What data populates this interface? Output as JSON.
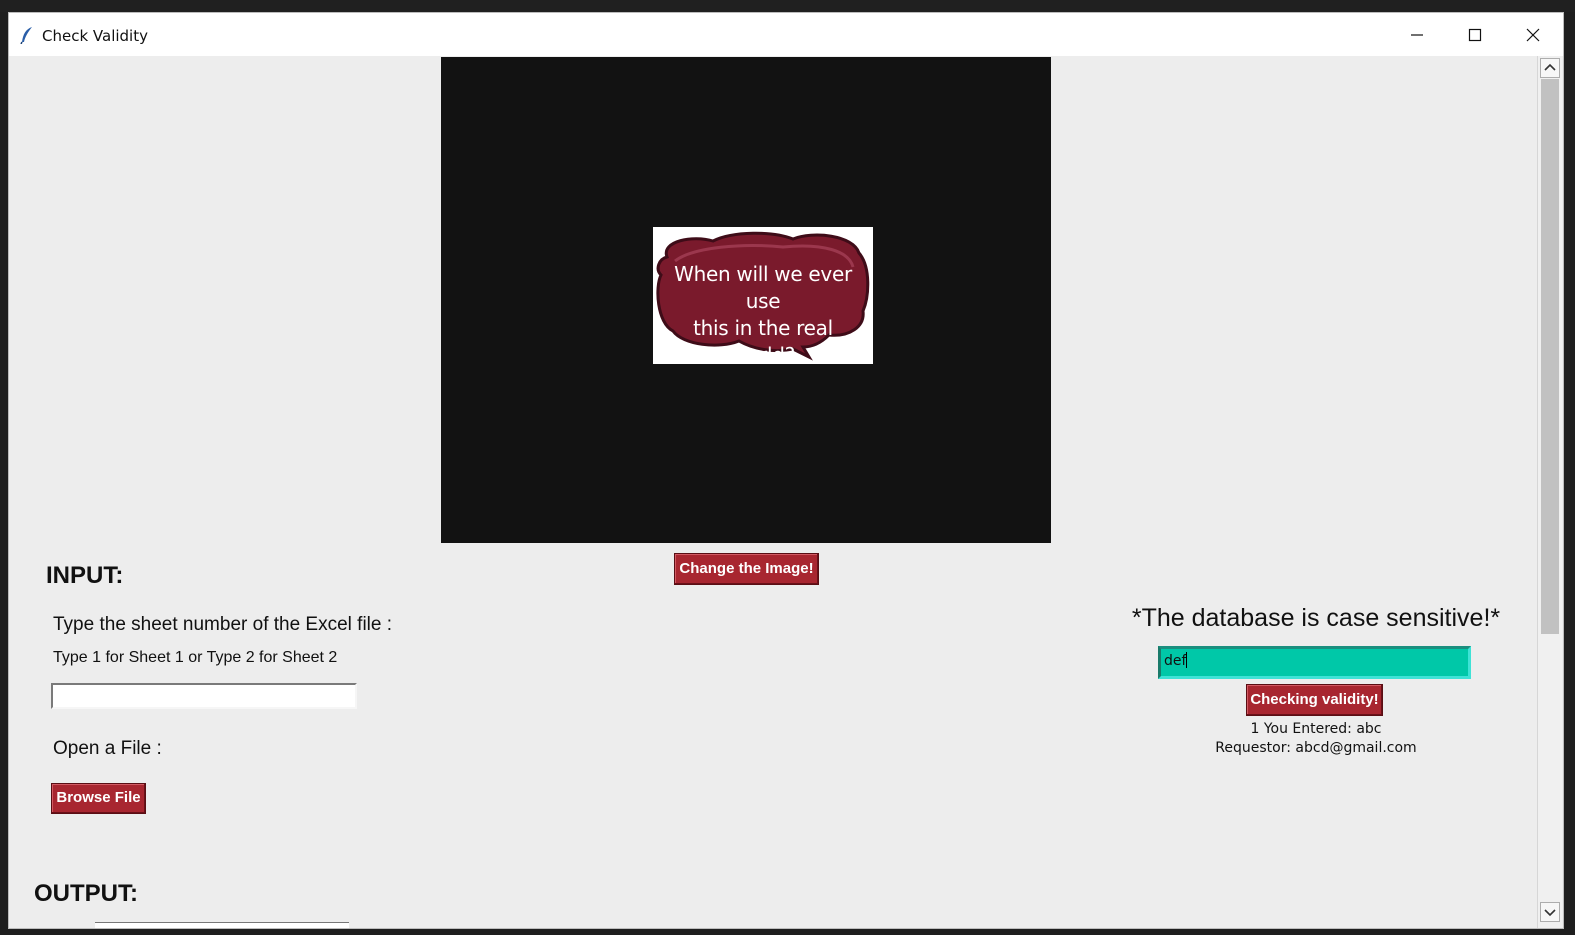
{
  "window": {
    "title": "Check Validity",
    "controls": {
      "minimize": "minimize-icon",
      "maximize": "maximize-icon",
      "close": "close-icon"
    }
  },
  "image_panel": {
    "caption_lines": [
      "When will we ever use",
      "this in the real world?"
    ],
    "bubble_color": "#7a1a2c"
  },
  "buttons": {
    "change_image": "Change the Image!",
    "browse_file": "Browse File",
    "check_validity": "Checking validity!"
  },
  "input_section": {
    "heading": "INPUT:",
    "sheet_prompt": "Type the sheet number of the Excel file :",
    "sheet_hint": "Type 1 for Sheet 1 or Type 2 for Sheet 2",
    "sheet_value": "",
    "open_file_label": "Open a File :"
  },
  "output_section": {
    "heading": "OUTPUT:"
  },
  "database": {
    "notice": "*The database is case sensitive!*",
    "search_value": "def",
    "result_line": "1 You Entered: abc",
    "requestor_line": "Requestor:  abcd@gmail.com"
  },
  "colors": {
    "button_red": "#a82630",
    "entry_teal": "#00c8a8",
    "panel_black": "#121212"
  }
}
